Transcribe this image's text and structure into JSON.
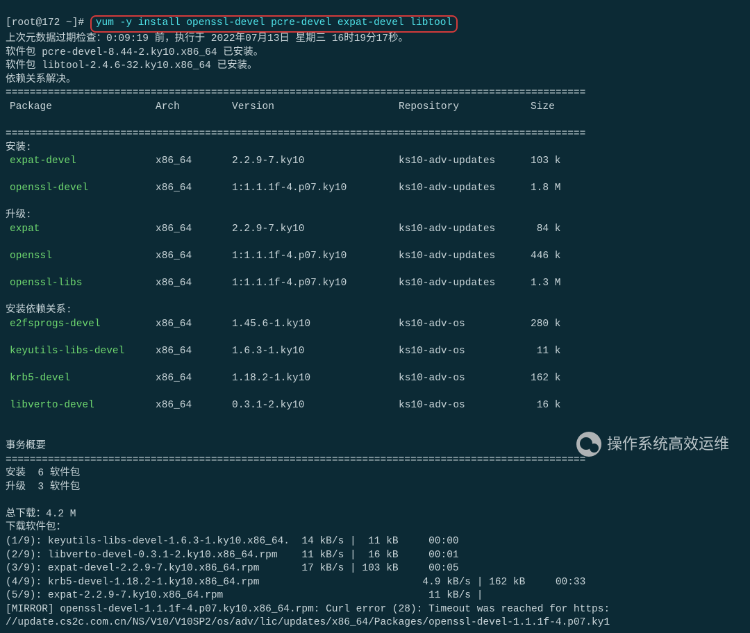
{
  "prompt": "[root@172 ~]#",
  "command": "yum -y install openssl-devel pcre-devel expat-devel libtool",
  "preamble": [
    "上次元数据过期检查：0:09:19 前，执行于 2022年07月13日 星期三 16时19分17秒。",
    "软件包 pcre-devel-8.44-2.ky10.x86_64 已安装。",
    "软件包 libtool-2.4.6-32.ky10.x86_64 已安装。",
    "依赖关系解决。"
  ],
  "div_long": "================================================================================================",
  "headers": {
    "pkg": "Package",
    "arch": "Arch",
    "ver": "Version",
    "repo": "Repository",
    "size": "Size"
  },
  "sections": {
    "install": {
      "label": "安装:",
      "rows": [
        {
          "pkg": "expat-devel",
          "arch": "x86_64",
          "ver": "2.2.9-7.ky10",
          "repo": "ks10-adv-updates",
          "size": "103 k"
        },
        {
          "pkg": "openssl-devel",
          "arch": "x86_64",
          "ver": "1:1.1.1f-4.p07.ky10",
          "repo": "ks10-adv-updates",
          "size": "1.8 M"
        }
      ]
    },
    "upgrade": {
      "label": "升级:",
      "rows": [
        {
          "pkg": "expat",
          "arch": "x86_64",
          "ver": "2.2.9-7.ky10",
          "repo": "ks10-adv-updates",
          "size": " 84 k"
        },
        {
          "pkg": "openssl",
          "arch": "x86_64",
          "ver": "1:1.1.1f-4.p07.ky10",
          "repo": "ks10-adv-updates",
          "size": "446 k"
        },
        {
          "pkg": "openssl-libs",
          "arch": "x86_64",
          "ver": "1:1.1.1f-4.p07.ky10",
          "repo": "ks10-adv-updates",
          "size": "1.3 M"
        }
      ]
    },
    "deps": {
      "label": "安装依赖关系:",
      "rows": [
        {
          "pkg": "e2fsprogs-devel",
          "arch": "x86_64",
          "ver": "1.45.6-1.ky10",
          "repo": "ks10-adv-os",
          "size": "280 k"
        },
        {
          "pkg": "keyutils-libs-devel",
          "arch": "x86_64",
          "ver": "1.6.3-1.ky10",
          "repo": "ks10-adv-os",
          "size": " 11 k"
        },
        {
          "pkg": "krb5-devel",
          "arch": "x86_64",
          "ver": "1.18.2-1.ky10",
          "repo": "ks10-adv-os",
          "size": "162 k"
        },
        {
          "pkg": "libverto-devel",
          "arch": "x86_64",
          "ver": "0.3.1-2.ky10",
          "repo": "ks10-adv-os",
          "size": " 16 k"
        }
      ]
    }
  },
  "summary_title": "事务概要",
  "summary_lines": [
    "安装  6 软件包",
    "升级  3 软件包"
  ],
  "total_dl": "总下载：4.2 M",
  "dl_title": "下载软件包：",
  "downloads": [
    "(1/9): keyutils-libs-devel-1.6.3-1.ky10.x86_64.  14 kB/s |  11 kB     00:00",
    "(2/9): libverto-devel-0.3.1-2.ky10.x86_64.rpm    11 kB/s |  16 kB     00:01",
    "(3/9): expat-devel-2.2.9-7.ky10.x86_64.rpm       17 kB/s | 103 kB     00:05",
    "(4/9): krb5-devel-1.18.2-1.ky10.x86_64.rpm                           4.9 kB/s | 162 kB     00:33",
    "(5/9): expat-2.2.9-7.ky10.x86_64.rpm                                  11 kB/s |",
    "[MIRROR] openssl-devel-1.1.1f-4.p07.ky10.x86_64.rpm: Curl error (28): Timeout was reached for https:",
    "//update.cs2c.com.cn/NS/V10/V10SP2/os/adv/lic/updates/x86_64/Packages/openssl-devel-1.1.1f-4.p07.ky1"
  ],
  "watermark": "操作系统高效运维"
}
